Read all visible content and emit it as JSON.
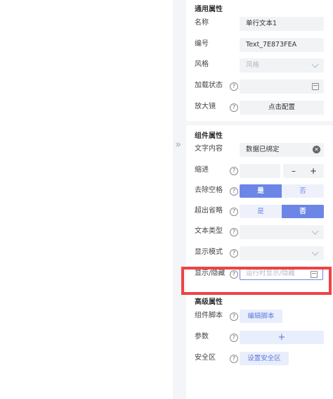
{
  "common_section": {
    "title": "通用属性",
    "name_label": "名称",
    "name_value": "单行文本1",
    "code_label": "编号",
    "code_value": "Text_7E873FEA",
    "style_label": "风格",
    "style_placeholder": "风格",
    "loading_label": "加载状态",
    "magnifier_label": "放大镜",
    "magnifier_button": "点击配置"
  },
  "component_section": {
    "title": "组件属性",
    "content_label": "文字内容",
    "content_value": "数据已绑定",
    "indent_label": "缩进",
    "indent_minus": "–",
    "indent_plus": "+",
    "trim_label": "去除空格",
    "trim_yes": "是",
    "trim_no": "否",
    "trim_selected": "是",
    "ellipsis_label": "超出省略",
    "ellipsis_yes": "是",
    "ellipsis_no": "否",
    "ellipsis_selected": "否",
    "text_type_label": "文本类型",
    "display_mode_label": "显示模式",
    "show_hide_label": "显示/隐藏",
    "show_hide_placeholder": "运行时显示/隐藏"
  },
  "advanced_section": {
    "title": "高级属性",
    "script_label": "组件脚本",
    "script_button": "编辑脚本",
    "params_label": "参数",
    "params_add": "+",
    "safe_area_label": "安全区",
    "safe_area_button": "设置安全区"
  },
  "icons": {
    "collapse": "»",
    "help": "?",
    "clear": "✕"
  },
  "colors": {
    "accent": "#6b86e6",
    "highlight": "#ee4343",
    "field_bg": "#f2f3f5",
    "panel_gap": "#f4f5f8"
  }
}
